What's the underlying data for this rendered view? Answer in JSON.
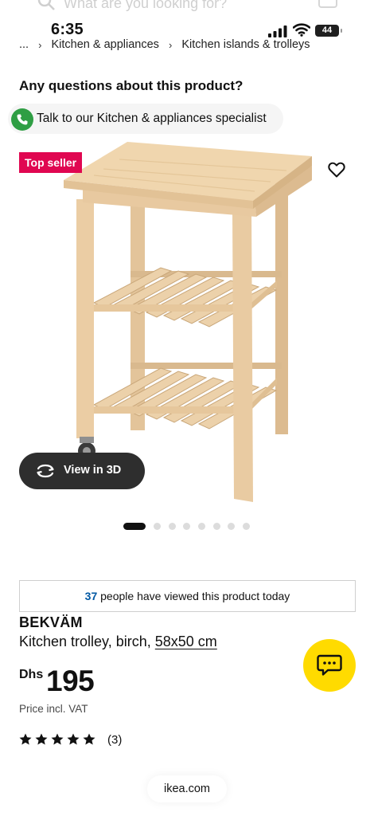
{
  "search": {
    "placeholder": "What are you looking for?"
  },
  "status_bar": {
    "time": "6:35",
    "battery": "44"
  },
  "breadcrumb": {
    "items": [
      "...",
      "Kitchen & appliances",
      "Kitchen islands & trolleys"
    ]
  },
  "questions": {
    "title": "Any questions about this product?",
    "specialist_link": "Talk to our Kitchen & appliances specialist"
  },
  "product_image": {
    "badge": "Top seller",
    "view_3d_label": "View in 3D",
    "carousel_count": 8,
    "carousel_active_index": 0
  },
  "viewed_notice": {
    "count": "37",
    "text": "people have viewed this product today"
  },
  "product": {
    "name": "BEKVÄM",
    "description": "Kitchen trolley, birch,",
    "size": "58x50 cm",
    "currency": "Dhs",
    "price": "195",
    "price_note": "Price incl. VAT",
    "rating_stars": 5,
    "review_count": "(3)"
  },
  "footer": {
    "domain": "ikea.com"
  },
  "icons": {
    "phone": "phone-icon",
    "wishlist": "heart-icon",
    "rotate": "rotate-3d-icon",
    "chat": "chat-icon",
    "star": "star-icon"
  },
  "colors": {
    "badge_red": "#e00751",
    "ikea_blue": "#0058a3",
    "chat_yellow": "#ffdb00",
    "phone_green": "#2f9e44",
    "wood": "#e8c9a0"
  }
}
